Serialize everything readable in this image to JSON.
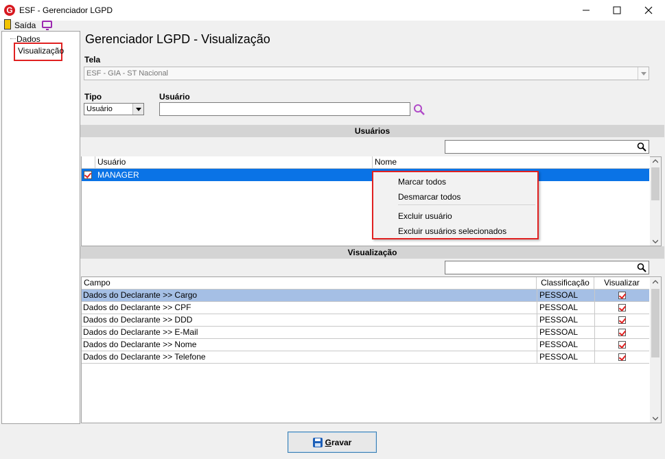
{
  "window": {
    "title": "ESF - Gerenciador LGPD",
    "logo_letter": "G"
  },
  "menu": {
    "saida_label": "Saída"
  },
  "tree": {
    "items": [
      {
        "label": "Dados"
      },
      {
        "label": "Visualização"
      }
    ]
  },
  "page": {
    "title": "Gerenciador LGPD - Visualização"
  },
  "tela": {
    "label": "Tela",
    "value": "ESF - GIA - ST Nacional"
  },
  "tipo": {
    "label": "Tipo",
    "value": "Usuário"
  },
  "usuario": {
    "label": "Usuário",
    "value": ""
  },
  "usuarios_section": {
    "title": "Usuários",
    "columns": [
      "Usuário",
      "Nome"
    ],
    "rows": [
      {
        "checked": true,
        "usuario": "MANAGER",
        "nome": ""
      }
    ]
  },
  "context_menu": {
    "items": [
      "Marcar todos",
      "Desmarcar todos",
      "Excluir usuário",
      "Excluir usuários selecionados"
    ]
  },
  "visualizacao_section": {
    "title": "Visualização",
    "columns": [
      "Campo",
      "Classificação",
      "Visualizar"
    ],
    "rows": [
      {
        "campo": "Dados do Declarante >> Cargo",
        "classificacao": "PESSOAL",
        "visualizar": true
      },
      {
        "campo": "Dados do Declarante >> CPF",
        "classificacao": "PESSOAL",
        "visualizar": true
      },
      {
        "campo": "Dados do Declarante >> DDD",
        "classificacao": "PESSOAL",
        "visualizar": true
      },
      {
        "campo": "Dados do Declarante >> E-Mail",
        "classificacao": "PESSOAL",
        "visualizar": true
      },
      {
        "campo": "Dados do Declarante >> Nome",
        "classificacao": "PESSOAL",
        "visualizar": true
      },
      {
        "campo": "Dados do Declarante >> Telefone",
        "classificacao": "PESSOAL",
        "visualizar": true
      }
    ]
  },
  "actions": {
    "gravar_first": "G",
    "gravar_rest": "ravar"
  },
  "colors": {
    "accent_blue": "#0a73e6",
    "highlight_red": "#e02020",
    "selected_row": "#a5bfe5"
  },
  "icons": [
    "app-logo-icon",
    "exit-door-icon",
    "monitor-icon",
    "search-icon",
    "save-floppy-icon",
    "dropdown-arrow-icon",
    "minimize-icon",
    "maximize-icon",
    "close-icon"
  ]
}
